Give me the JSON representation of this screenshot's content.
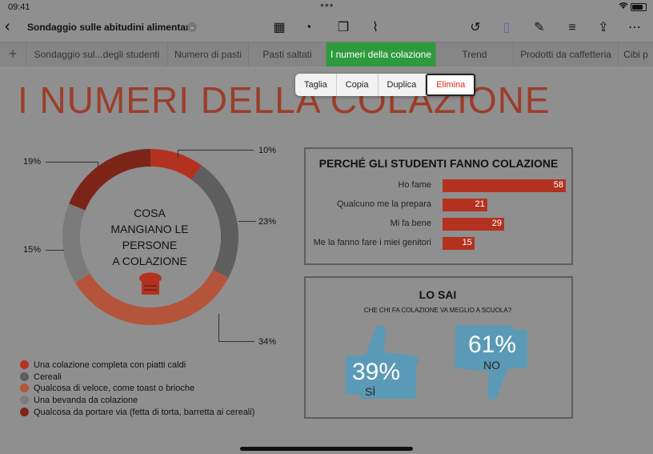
{
  "status": {
    "time": "09:41",
    "dots": "•••"
  },
  "toolbar": {
    "back": "‹",
    "title": "Sondaggio sulle abitudini alimentari",
    "chevron": "⌄",
    "icons": [
      {
        "name": "table-icon",
        "glyph": "▦"
      },
      {
        "name": "chart-icon",
        "glyph": "◔"
      },
      {
        "name": "shapes-icon",
        "glyph": "❐"
      },
      {
        "name": "attachment-icon",
        "glyph": "⌇"
      },
      {
        "name": "undo-icon",
        "glyph": "↺"
      },
      {
        "name": "clipboard-icon",
        "glyph": "▯"
      },
      {
        "name": "format-brush-icon",
        "glyph": "✎"
      },
      {
        "name": "filter-icon",
        "glyph": "≡"
      },
      {
        "name": "share-icon",
        "glyph": "⇪"
      },
      {
        "name": "more-icon",
        "glyph": "⋯"
      }
    ]
  },
  "tabs": {
    "add": "+",
    "items": [
      "Sondaggio sul...degli studenti",
      "Numero di pasti",
      "Pasti saltati",
      "I numeri della colazione",
      "Trend",
      "Prodotti da caffetteria",
      "Cibi p"
    ],
    "active": 3
  },
  "context_menu": {
    "items": [
      "Taglia",
      "Copia",
      "Duplica",
      "Elimina"
    ]
  },
  "page": {
    "title": "I NUMERI DELLA COLAZIONE"
  },
  "donut": {
    "center_lines": [
      "COSA",
      "MANGIANO LE",
      "PERSONE",
      "A COLAZIONE"
    ],
    "slices": [
      {
        "label": "10%",
        "value": 10,
        "color": "#b3321f"
      },
      {
        "label": "23%",
        "value": 23,
        "color": "#5e5e5e"
      },
      {
        "label": "34%",
        "value": 34,
        "color": "#b4543a"
      },
      {
        "label": "15%",
        "value": 15,
        "color": "#7b7b7b"
      },
      {
        "label": "19%",
        "value": 19,
        "color": "#7d2418"
      }
    ],
    "legend": [
      {
        "text": "Una colazione completa con piatti caldi",
        "color": "#b3321f"
      },
      {
        "text": "Cereali",
        "color": "#5e5e5e"
      },
      {
        "text": "Qualcosa di veloce, come toast o brioche",
        "color": "#b4543a"
      },
      {
        "text": "Una bevanda da colazione",
        "color": "#7b7b7b"
      },
      {
        "text": "Qualcosa da portare via (fetta di torta, barretta ai cereali)",
        "color": "#7d2418"
      }
    ]
  },
  "chart_data": [
    {
      "type": "pie",
      "title": "COSA MANGIANO LE PERSONE A COLAZIONE",
      "categories": [
        "Una colazione completa con piatti caldi",
        "Cereali",
        "Qualcosa di veloce, come toast o brioche",
        "Una bevanda da colazione",
        "Qualcosa da portare via (fetta di torta, barretta ai cereali)"
      ],
      "values": [
        10,
        23,
        34,
        15,
        19
      ]
    },
    {
      "type": "bar",
      "title": "PERCHÉ GLI STUDENTI FANNO COLAZIONE",
      "categories": [
        "Ho fame",
        "Qualcuno me la prepara",
        "Mi fa bene",
        "Me la fanno fare i miei genitori"
      ],
      "values": [
        58,
        21,
        29,
        15
      ],
      "xlim": [
        0,
        58
      ]
    }
  ],
  "reasons": {
    "title": "PERCHÉ GLI STUDENTI FANNO COLAZIONE"
  },
  "didyouknow": {
    "title": "LO SAI",
    "subtitle": "CHE CHI FA COLAZIONE VA MEGLIO A SCUOLA?",
    "yes_pct": "39%",
    "yes_label": "SÌ",
    "no_pct": "61%",
    "no_label": "NO",
    "thumb_color": "#5b9ab6"
  }
}
